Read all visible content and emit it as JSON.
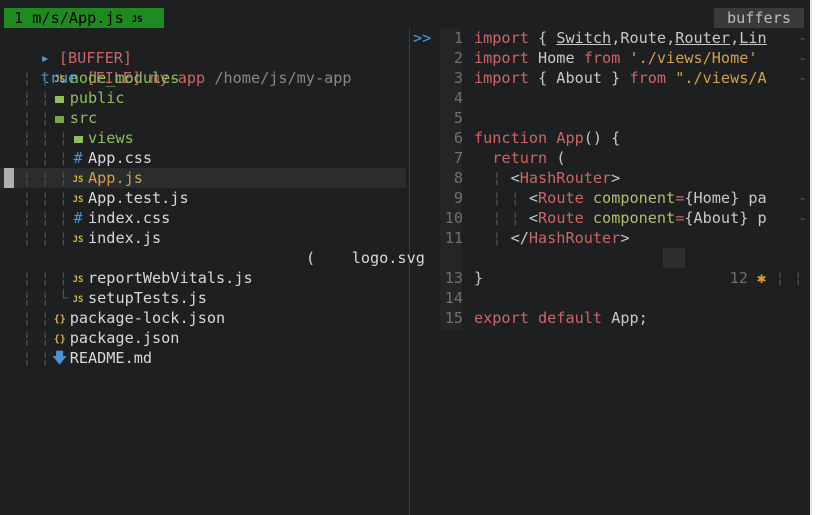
{
  "tabline": {
    "active_tab": "1 m/s/App.js",
    "active_tab_icon": "JS",
    "right_label": "buffers"
  },
  "tree": {
    "buffer_header": {
      "arrow": "▸",
      "label": "[BUFFER]"
    },
    "file_header": {
      "prefix": "true",
      "tag": "[FILE]",
      "name": "my-app",
      "path": "/home/js/my-app"
    },
    "rows": [
      {
        "indent": "  ¦ ¦",
        "icon": "js",
        "name": "node_modules",
        "color": "green"
      },
      {
        "indent": "  ¦ ¦",
        "icon": "folder",
        "name": "public",
        "color": "green"
      },
      {
        "indent": "  ¦ ¦",
        "icon": "folder-open",
        "name": "src",
        "color": "green"
      },
      {
        "indent": "  ¦ ¦ ¦",
        "icon": "folder",
        "name": "views",
        "color": "green"
      },
      {
        "indent": "  ¦ ¦ ¦",
        "icon": "css",
        "name": "App.css",
        "color": "white"
      },
      {
        "indent": "  ¦ ¦ ¦",
        "icon": "js",
        "name": "App.js",
        "color": "orange",
        "selected": true
      },
      {
        "indent": "  ¦ ¦ ¦",
        "icon": "js",
        "name": "App.test.js",
        "color": "white"
      },
      {
        "indent": "  ¦ ¦ ¦",
        "icon": "css",
        "name": "index.css",
        "color": "white"
      },
      {
        "indent": "  ¦ ¦ ¦",
        "icon": "js",
        "name": "index.js",
        "color": "white"
      },
      {
        "indent": "",
        "icon": "none",
        "name": "",
        "color": "white",
        "floating": "(    logo.svg"
      },
      {
        "indent": "  ¦ ¦ ¦",
        "icon": "js",
        "name": "reportWebVitals.js",
        "color": "white"
      },
      {
        "indent": "  ¦ ¦ └",
        "icon": "js",
        "name": "setupTests.js",
        "color": "white"
      },
      {
        "indent": "  ¦ ¦",
        "icon": "json",
        "name": "package-lock.json",
        "color": "white"
      },
      {
        "indent": "  ¦ ¦",
        "icon": "json",
        "name": "package.json",
        "color": "white"
      },
      {
        "indent": "  ¦ ¦",
        "icon": "md",
        "name": "README.md",
        "color": "white"
      }
    ]
  },
  "code": {
    "prompt": ">>",
    "lines": [
      {
        "n": "1",
        "tokens": [
          [
            "kw",
            "import"
          ],
          [
            "id",
            " { "
          ],
          [
            "ul",
            "Switch"
          ],
          [
            "id",
            ","
          ],
          [
            "id",
            "Route"
          ],
          [
            "id",
            ","
          ],
          [
            "ul",
            "Router"
          ],
          [
            "id",
            ","
          ],
          [
            "ul",
            "Lin"
          ]
        ],
        "more": true
      },
      {
        "n": "2",
        "tokens": [
          [
            "kw",
            "import"
          ],
          [
            "id",
            " Home "
          ],
          [
            "kw",
            "from"
          ],
          [
            "id",
            " "
          ],
          [
            "str",
            "'./views/Home'"
          ]
        ],
        "more": true
      },
      {
        "n": "3",
        "tokens": [
          [
            "kw",
            "import"
          ],
          [
            "id",
            " { About } "
          ],
          [
            "kw",
            "from"
          ],
          [
            "id",
            " "
          ],
          [
            "str",
            "\"./views/A"
          ]
        ],
        "more": true
      },
      {
        "n": "4",
        "tokens": []
      },
      {
        "n": "5",
        "tokens": []
      },
      {
        "n": "6",
        "tokens": [
          [
            "kw",
            "function"
          ],
          [
            "id",
            " "
          ],
          [
            "fn",
            "App"
          ],
          [
            "id",
            "() {"
          ]
        ]
      },
      {
        "n": "7",
        "tokens": [
          [
            "id",
            "  "
          ],
          [
            "kw",
            "return"
          ],
          [
            "id",
            " ("
          ]
        ]
      },
      {
        "n": "8",
        "tokens": [
          [
            "guide",
            "  ¦ "
          ],
          [
            "id",
            "<"
          ],
          [
            "tag",
            "HashRouter"
          ],
          [
            "id",
            ">"
          ]
        ]
      },
      {
        "n": "9",
        "tokens": [
          [
            "guide",
            "  ¦ ¦ "
          ],
          [
            "id",
            "<"
          ],
          [
            "tag",
            "Route"
          ],
          [
            "id",
            " "
          ],
          [
            "attr",
            "component"
          ],
          [
            "kw",
            "="
          ],
          [
            "id",
            "{Home} pa"
          ]
        ],
        "more": true
      },
      {
        "n": "10",
        "tokens": [
          [
            "guide",
            "  ¦ ¦ "
          ],
          [
            "id",
            "<"
          ],
          [
            "tag",
            "Route"
          ],
          [
            "id",
            " "
          ],
          [
            "attr",
            "component"
          ],
          [
            "kw",
            "="
          ],
          [
            "id",
            "{About} p"
          ]
        ],
        "more": true
      },
      {
        "n": "11",
        "tokens": [
          [
            "guide",
            "  ¦ "
          ],
          [
            "id",
            "</"
          ],
          [
            "tag",
            "HashRouter"
          ],
          [
            "id",
            ">"
          ]
        ]
      },
      {
        "n": "12",
        "tokens": []
      },
      {
        "n": "13",
        "tokens": [
          [
            "id",
            "}"
          ]
        ]
      },
      {
        "n": "14",
        "tokens": []
      },
      {
        "n": "15",
        "tokens": [
          [
            "kw",
            "export"
          ],
          [
            "id",
            " "
          ],
          [
            "kw",
            "default"
          ],
          [
            "id",
            " App;"
          ]
        ]
      }
    ],
    "line12_overlay": {
      "number": "12",
      "mark": "✱",
      "guides": "¦ ¦"
    }
  }
}
